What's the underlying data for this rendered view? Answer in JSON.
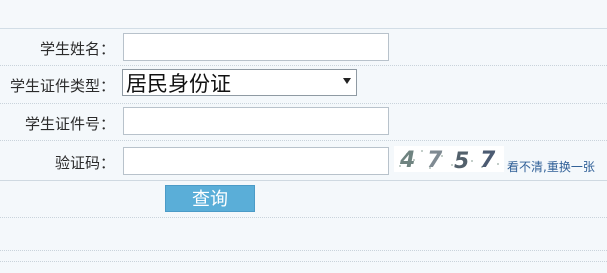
{
  "form": {
    "student_name_label": "学生姓名：",
    "cert_type_label": "学生证件类型：",
    "cert_type_value": "居民身份证",
    "cert_no_label": "学生证件号：",
    "captcha_label": "验证码：",
    "captcha_text": "4757",
    "refresh_link": "看不清,重换一张",
    "submit_button": "查询"
  }
}
